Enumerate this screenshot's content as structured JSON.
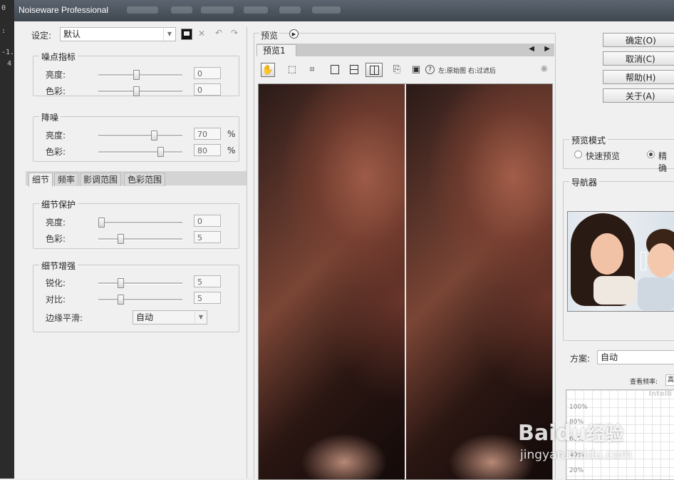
{
  "host": {
    "glyph1": "0",
    "glyph2": ":",
    "glyph3": "-1.",
    "glyph4": "4"
  },
  "window": {
    "title": "Noiseware Professional"
  },
  "settings": {
    "label": "设定:",
    "value": "默认"
  },
  "noise_level": {
    "title": "噪点指标",
    "brightness_label": "亮度:",
    "brightness_value": "0",
    "brightness_level": 0.45,
    "color_label": "色彩:",
    "color_value": "0",
    "color_level": 0.45
  },
  "denoise": {
    "title": "降噪",
    "brightness_label": "亮度:",
    "brightness_value": "70",
    "brightness_level": 0.68,
    "color_label": "色彩:",
    "color_value": "80",
    "color_level": 0.76,
    "percent": "%"
  },
  "tabs": [
    "细节",
    "频率",
    "影调范围",
    "色彩范围"
  ],
  "detail_protect": {
    "title": "细节保护",
    "brightness_label": "亮度:",
    "brightness_value": "0",
    "brightness_level": 0.0,
    "color_label": "色彩:",
    "color_value": "5",
    "color_level": 0.25
  },
  "detail_enhance": {
    "title": "细节增强",
    "sharpen_label": "锐化:",
    "sharpen_value": "5",
    "sharpen_level": 0.25,
    "contrast_label": "对比:",
    "contrast_value": "5",
    "contrast_level": 0.25,
    "edge_label": "边缘平滑:",
    "edge_value": "自动"
  },
  "preview": {
    "title": "预览",
    "tab_label": "预览1",
    "hint": "左:原始图 右:过滤后"
  },
  "buttons": {
    "ok": "确定(O)",
    "cancel": "取消(C)",
    "help": "帮助(H)",
    "about": "关于(A)"
  },
  "preview_mode": {
    "title": "预览模式",
    "fast": "快速预览",
    "accurate": "精确"
  },
  "navigator": {
    "title": "导航器"
  },
  "scheme": {
    "label": "方案:",
    "value": "自动",
    "freq_label": "查看频率:",
    "freq_value": "高",
    "graph_title": "Intelli",
    "ticks": [
      "100%",
      "80%",
      "60%",
      "40%",
      "20%"
    ]
  },
  "watermark": {
    "brand": "Baidu",
    "brand_cn": "经验",
    "url": "jingyan.baidu.com"
  },
  "icons": [
    "save-icon",
    "delete-icon",
    "undo-icon",
    "redo-icon",
    "play-icon",
    "hand-tool-icon",
    "lasso-icon",
    "crop-select-icon",
    "single-view-icon",
    "split-horizontal-icon",
    "split-vertical-icon",
    "export-icon",
    "clipboard-icon",
    "help-icon",
    "busy-spinner-icon"
  ]
}
